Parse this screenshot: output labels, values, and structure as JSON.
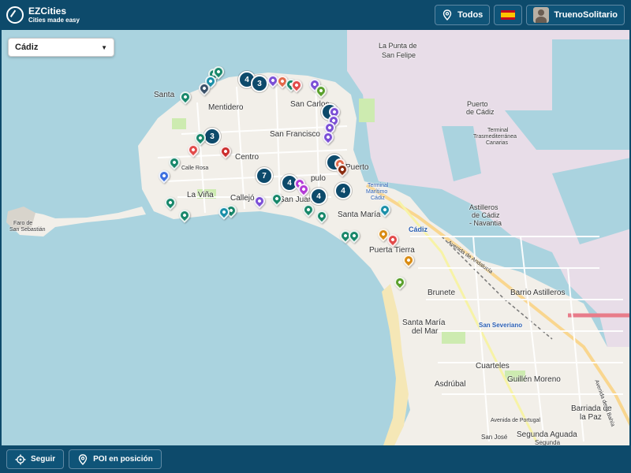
{
  "header": {
    "title": "EZCities",
    "subtitle": "Cities made easy",
    "filter_label": "Todos",
    "language_flag": "es-flag",
    "user_name": "TruenoSolitario"
  },
  "map": {
    "city_select": {
      "selected": "Cádiz"
    },
    "labels": {
      "punta": "La Punta de",
      "felipe": "San Felipe",
      "puerto_a": "Puerto",
      "puerto_b": "de Cádiz",
      "terminal_a": "Terminal",
      "terminal_b": "Trasmediterránea",
      "terminal_c": "Canarias",
      "santa": "Santa",
      "mentidero": "Mentidero",
      "sancarlos": "San Carlos",
      "sanfrancisco": "San Francisco",
      "centro": "Centro",
      "callerosa": "Calle Rosa",
      "lavina": "La Viña",
      "calleja": "Callejó",
      "sanjuan": "San Juan",
      "populo": "pulo",
      "puerto_c": "Puerto",
      "tm_a": "Terminal",
      "tm_b": "Marítimo",
      "tm_c": "Cádiz",
      "santamaria": "Santa María",
      "cadiz_station": "Cádiz",
      "astilleros_a": "Astilleros",
      "astilleros_b": "de Cádiz",
      "astilleros_c": "- Navantia",
      "puertatierra": "Puerta Tierra",
      "faro": "Faro de",
      "sansebastian": "San Sebastián",
      "brunete": "Brunete",
      "barrio": "Barrio Astilleros",
      "smm_a": "Santa María",
      "smm_b": "del Mar",
      "sanseveriano": "San Severiano",
      "cuarteles": "Cuarteles",
      "guillen": "Guillén Moreno",
      "asdrubal": "Asdrúbal",
      "barriada_a": "Barriada de",
      "barriada_b": "la Paz",
      "segunda": "Segunda Aguada",
      "sanjose": "San José",
      "segunda_small": "Segunda",
      "av_andalucia": "Avenida de Andalucía",
      "av_bahia": "Avenida de la Bahía",
      "av_portugal": "Avenida de Portugal"
    },
    "clusters": [
      "4",
      "3",
      "3",
      "7",
      "4",
      "4",
      "4"
    ]
  },
  "footer": {
    "follow_label": "Seguir",
    "poi_label": "POI en posición"
  },
  "colors": {
    "bar": "#0d4a6b",
    "water": "#aad3df",
    "land": "#f2efe9",
    "port": "#e6dde6",
    "poi_green": "#17876a",
    "poi_teal": "#1a8fa8",
    "poi_purple": "#7b4fd6",
    "poi_red": "#e24a4a",
    "poi_orange": "#d98b12",
    "poi_lime": "#5aa02c",
    "poi_blue": "#3d6fe0"
  }
}
